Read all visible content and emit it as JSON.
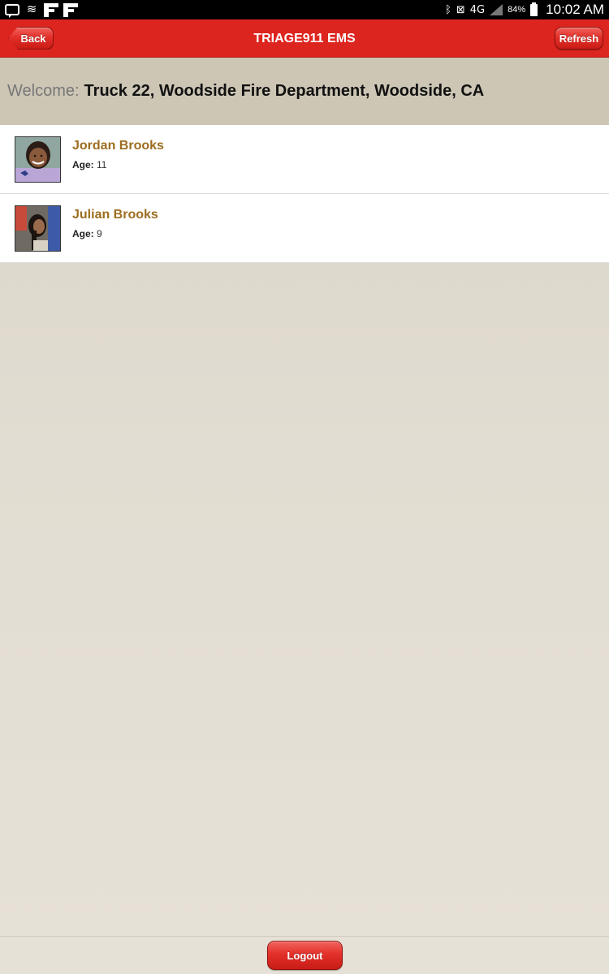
{
  "status_bar": {
    "battery_percent": "84%",
    "time": "10:02 AM",
    "network": "4G"
  },
  "header": {
    "title": "TRIAGE911 EMS",
    "back_label": "Back",
    "refresh_label": "Refresh"
  },
  "welcome": {
    "label": "Welcome:",
    "value": "Truck 22, Woodside Fire Department, Woodside, CA"
  },
  "patients": [
    {
      "name": "Jordan Brooks",
      "age_label": "Age:",
      "age": "11"
    },
    {
      "name": "Julian Brooks",
      "age_label": "Age:",
      "age": "9"
    }
  ],
  "footer": {
    "logout_label": "Logout"
  },
  "colors": {
    "header_red": "#dd2520",
    "name_gold": "#9c6d1f",
    "welcome_bg": "#cdc6b5"
  }
}
